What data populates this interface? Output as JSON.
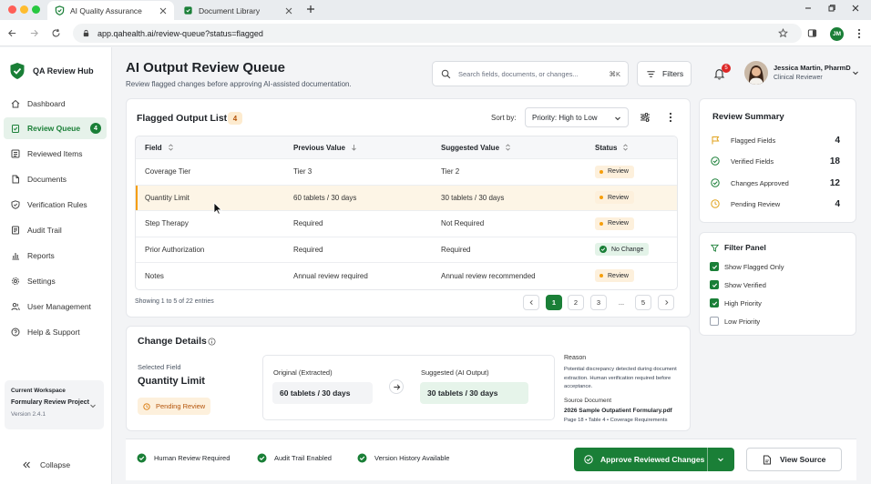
{
  "browser": {
    "tabs": [
      {
        "label": "AI Quality Assurance",
        "active": true
      },
      {
        "label": "Document Library",
        "active": false
      }
    ],
    "url": "app.qahealth.ai/review-queue?status=flagged",
    "profile_initials": "JM"
  },
  "sidebar": {
    "brand": "QA Review Hub",
    "items": [
      {
        "label": "Dashboard",
        "icon": "home-icon"
      },
      {
        "label": "Review Queue",
        "icon": "clipboard-check-icon",
        "badge": "4",
        "active": true
      },
      {
        "label": "Reviewed Items",
        "icon": "list-icon"
      },
      {
        "label": "Documents",
        "icon": "document-icon"
      },
      {
        "label": "Verification Rules",
        "icon": "shield-check-icon"
      },
      {
        "label": "Audit Trail",
        "icon": "doc-lines-icon"
      },
      {
        "label": "Reports",
        "icon": "bar-chart-icon"
      },
      {
        "label": "Settings",
        "icon": "gear-icon"
      },
      {
        "label": "User Management",
        "icon": "users-icon"
      },
      {
        "label": "Help & Support",
        "icon": "help-icon"
      }
    ],
    "workspace": {
      "caption": "Current Workspace",
      "name": "Formulary Review Project",
      "version": "Version 2.4.1"
    },
    "collapse_label": "Collapse"
  },
  "header": {
    "title": "AI Output Review Queue",
    "subtitle": "Review flagged changes before approving AI-assisted documentation.",
    "search_placeholder": "Search fields, documents, or changes...",
    "search_shortcut": "⌘K",
    "filters_label": "Filters",
    "notification_count": "5",
    "user_name": "Jessica Martin, PharmD",
    "user_role": "Clinical Reviewer"
  },
  "flagged_list": {
    "title": "Flagged Output List",
    "count": "4",
    "sort_label": "Sort by:",
    "sort_value": "Priority: High to Low",
    "columns": [
      "Field",
      "Previous Value",
      "Suggested Value",
      "Status"
    ],
    "rows": [
      {
        "field": "Coverage Tier",
        "previous": "Tier 3",
        "suggested": "Tier 2",
        "status": "Review",
        "status_type": "review",
        "selected": false
      },
      {
        "field": "Quantity Limit",
        "previous": "60 tablets / 30 days",
        "suggested": "30 tablets / 30 days",
        "status": "Review",
        "status_type": "review",
        "selected": true
      },
      {
        "field": "Step Therapy",
        "previous": "Required",
        "suggested": "Not Required",
        "status": "Review",
        "status_type": "review",
        "selected": false
      },
      {
        "field": "Prior Authorization",
        "previous": "Required",
        "suggested": "Required",
        "status": "No Change",
        "status_type": "nochange",
        "selected": false
      },
      {
        "field": "Notes",
        "previous": "Annual review required",
        "suggested": "Annual review recommended",
        "status": "Review",
        "status_type": "review",
        "selected": false
      }
    ],
    "showing": "Showing 1 to 5 of 22 entries",
    "pages": [
      "1",
      "2",
      "3",
      "...",
      "5"
    ],
    "current_page": "1"
  },
  "change_details": {
    "title": "Change Details",
    "selected_field_caption": "Selected Field",
    "selected_field": "Quantity Limit",
    "status": "Pending Review",
    "original_caption": "Original (Extracted)",
    "original_value": "60 tablets / 30 days",
    "suggested_caption": "Suggested (AI Output)",
    "suggested_value": "30 tablets / 30 days",
    "reason_heading": "Reason",
    "reason_text": "Potential discrepancy detected during document extraction. Human verification required before acceptance.",
    "source_heading": "Source Document",
    "source_file": "2026 Sample Outpatient Formulary.pdf",
    "source_location": "Page 18 • Table 4 • Coverage Requirements"
  },
  "review_summary": {
    "title": "Review Summary",
    "items": [
      {
        "label": "Flagged Fields",
        "value": "4",
        "icon": "flag-icon",
        "color": "#e0a21b"
      },
      {
        "label": "Verified Fields",
        "value": "18",
        "icon": "check-circle-icon",
        "color": "#1a7f37"
      },
      {
        "label": "Changes Approved",
        "value": "12",
        "icon": "check-circle-icon",
        "color": "#1a7f37"
      },
      {
        "label": "Pending Review",
        "value": "4",
        "icon": "clock-icon",
        "color": "#e0a21b"
      }
    ]
  },
  "filter_panel": {
    "title": "Filter Panel",
    "options": [
      {
        "label": "Show Flagged Only",
        "checked": true
      },
      {
        "label": "Show Verified",
        "checked": true
      },
      {
        "label": "High Priority",
        "checked": true
      },
      {
        "label": "Low Priority",
        "checked": false
      }
    ]
  },
  "footer": {
    "indicators": [
      "Human Review Required",
      "Audit Trail Enabled",
      "Version History Available"
    ],
    "approve_label": "Approve Reviewed Changes",
    "view_source_label": "View Source"
  },
  "colors": {
    "accent": "#1a7f37",
    "warning": "#f59e0b",
    "danger": "#dc2626"
  }
}
